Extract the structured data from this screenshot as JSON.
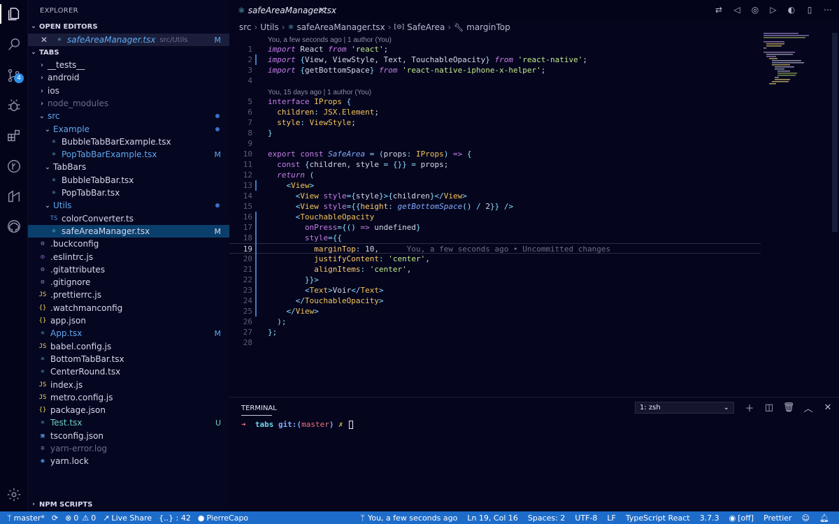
{
  "activity_bar": {
    "source_control_badge": "4"
  },
  "sidebar": {
    "title": "EXPLORER",
    "open_editors": {
      "header": "OPEN EDITORS",
      "items": [
        {
          "name": "safeAreaManager.tsx",
          "path": "src/Utils",
          "status": "M"
        }
      ]
    },
    "folder": {
      "header": "TABS",
      "tree": [
        {
          "label": "__tests__",
          "kind": "folder",
          "depth": 0,
          "open": false
        },
        {
          "label": "android",
          "kind": "folder",
          "depth": 0,
          "open": false
        },
        {
          "label": "ios",
          "kind": "folder",
          "depth": 0,
          "open": false
        },
        {
          "label": "node_modules",
          "kind": "folder",
          "depth": 0,
          "open": false
        },
        {
          "label": "src",
          "kind": "folder",
          "depth": 0,
          "open": true
        },
        {
          "label": "Example",
          "kind": "folder",
          "depth": 1,
          "open": true
        },
        {
          "label": "BubbleTabBarExample.tsx",
          "kind": "react",
          "depth": 2
        },
        {
          "label": "PopTabBarExample.tsx",
          "kind": "react",
          "depth": 2,
          "status": "M"
        },
        {
          "label": "TabBars",
          "kind": "folder",
          "depth": 1,
          "open": true
        },
        {
          "label": "BubbleTabBar.tsx",
          "kind": "react",
          "depth": 2
        },
        {
          "label": "PopTabBar.tsx",
          "kind": "react",
          "depth": 2
        },
        {
          "label": "Utils",
          "kind": "folder",
          "depth": 1,
          "open": true
        },
        {
          "label": "colorConverter.ts",
          "kind": "ts",
          "depth": 2,
          "icon_text": "TS"
        },
        {
          "label": "safeAreaManager.tsx",
          "kind": "react",
          "depth": 2,
          "status": "M"
        },
        {
          "label": ".buckconfig",
          "kind": "gear",
          "depth": 0
        },
        {
          "label": ".eslintrc.js",
          "kind": "eslint",
          "depth": 0
        },
        {
          "label": ".gitattributes",
          "kind": "gear",
          "depth": 0
        },
        {
          "label": ".gitignore",
          "kind": "gear",
          "depth": 0
        },
        {
          "label": ".prettierrc.js",
          "kind": "js",
          "depth": 0,
          "icon_text": "JS"
        },
        {
          "label": ".watchmanconfig",
          "kind": "json",
          "depth": 0,
          "icon_text": "{}"
        },
        {
          "label": "app.json",
          "kind": "json",
          "depth": 0,
          "icon_text": "{}"
        },
        {
          "label": "App.tsx",
          "kind": "react",
          "depth": 0,
          "status": "M"
        },
        {
          "label": "babel.config.js",
          "kind": "js",
          "depth": 0,
          "icon_text": "JS"
        },
        {
          "label": "BottomTabBar.tsx",
          "kind": "react",
          "depth": 0
        },
        {
          "label": "CenterRound.tsx",
          "kind": "react",
          "depth": 0
        },
        {
          "label": "index.js",
          "kind": "js",
          "depth": 0,
          "icon_text": "JS"
        },
        {
          "label": "metro.config.js",
          "kind": "js",
          "depth": 0,
          "icon_text": "JS"
        },
        {
          "label": "package.json",
          "kind": "json",
          "depth": 0,
          "icon_text": "{}"
        },
        {
          "label": "Test.tsx",
          "kind": "react",
          "depth": 0,
          "status": "U"
        },
        {
          "label": "tsconfig.json",
          "kind": "tsconfig",
          "depth": 0
        },
        {
          "label": "yarn-error.log",
          "kind": "log",
          "depth": 0
        },
        {
          "label": "yarn.lock",
          "kind": "yarn",
          "depth": 0
        }
      ]
    },
    "npm_scripts": {
      "header": "NPM SCRIPTS"
    }
  },
  "editor": {
    "tab": {
      "label": "safeAreaManager.tsx"
    },
    "breadcrumbs": [
      "src",
      "Utils",
      "safeAreaManager.tsx",
      "SafeArea",
      "marginTop"
    ],
    "code_lens": [
      {
        "text": "You, a few seconds ago | 1 author (You)"
      },
      {
        "text": "You, 15 days ago | 1 author (You)"
      }
    ],
    "inline_blame": "You, a few seconds ago • Uncommitted changes",
    "line_numbers": [
      "1",
      "2",
      "3",
      "4",
      "5",
      "6",
      "7",
      "8",
      "9",
      "10",
      "11",
      "12",
      "13",
      "14",
      "15",
      "16",
      "17",
      "18",
      "19",
      "20",
      "21",
      "22",
      "23",
      "24",
      "25",
      "26",
      "27",
      "28"
    ]
  },
  "terminal": {
    "title": "TERMINAL",
    "shell_select": "1: zsh",
    "prompt_arrow": "➜",
    "prompt_dir": "tabs",
    "prompt_git": "git:(",
    "prompt_branch": "master",
    "prompt_git_close": ")",
    "prompt_dirty": "✗"
  },
  "status_bar": {
    "branch": "master*",
    "errors": "0",
    "warnings": "0",
    "live_share": "Live Share",
    "symbols": "{..} : 42",
    "user": "PierreCapo",
    "blame": "You, a few seconds ago",
    "position": "Ln 19, Col 16",
    "spaces": "Spaces: 2",
    "encoding": "UTF-8",
    "eol": "LF",
    "language": "TypeScript React",
    "ts_version": "3.7.3",
    "off": "[off]",
    "formatter": "Prettier"
  },
  "colors": {
    "accent": "#1e6cc9",
    "background": "#05061d",
    "selection": "#0a3f6c"
  }
}
